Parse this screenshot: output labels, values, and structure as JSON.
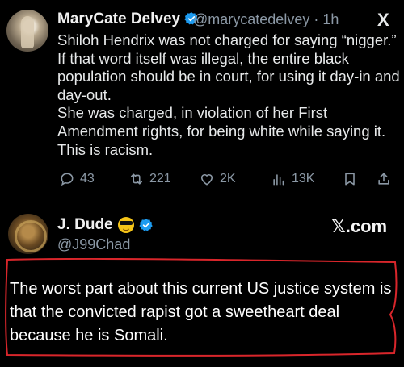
{
  "tweet1": {
    "display_name": "MaryCate Delvey",
    "handle_time": "@marycatedelvey · 1h",
    "text": "Shiloh Hendrix was not charged for saying “nigger.”\nIf that word itself was illegal, the entire black population should be in court, for using it day-in and day-out.\nShe was charged, in violation of her First Amendment rights, for being white while saying it.\nThis is racism.",
    "actions": {
      "replies": "43",
      "reposts": "221",
      "likes": "2K",
      "views": "13K"
    },
    "platform_logo": "X"
  },
  "tweet2": {
    "display_name": "J. Dude",
    "handle": "@J99Chad",
    "brand": "𝕏.com",
    "text": "The worst part about this current US justice system is that the convicted rapist got a sweetheart deal because he is Somali."
  },
  "colors": {
    "background": "#000000",
    "text": "#e7e9ea",
    "muted": "#8b98a5",
    "verified": "#1d9bf0",
    "annotation": "#d9262b"
  },
  "icons": [
    "verified-badge-icon",
    "x-logo-icon",
    "reply-icon",
    "repost-icon",
    "like-icon",
    "views-icon",
    "bookmark-icon",
    "share-icon",
    "sunglasses-emoji-icon"
  ]
}
